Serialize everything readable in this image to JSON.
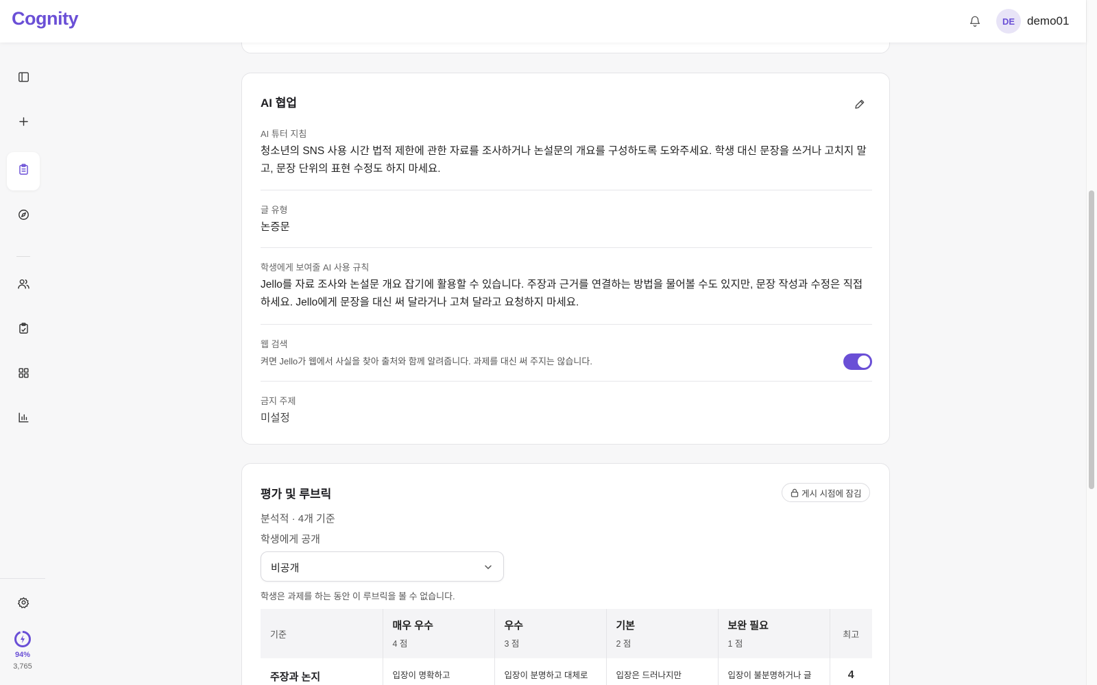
{
  "header": {
    "logo": "Cognity",
    "avatar_initials": "DE",
    "username": "demo01"
  },
  "sidebar": {
    "items": [
      {
        "icon": "sidebar-toggle-icon"
      },
      {
        "icon": "plus-icon"
      },
      {
        "icon": "clipboard-icon",
        "active": true
      },
      {
        "icon": "compass-icon"
      },
      {
        "icon": "users-icon"
      },
      {
        "icon": "clipboard-check-icon"
      },
      {
        "icon": "grid-icon"
      },
      {
        "icon": "bar-chart-icon"
      },
      {
        "icon": "gear-icon"
      }
    ],
    "usage_percent": "94%",
    "usage_count": "3,765"
  },
  "ai_section": {
    "title": "AI 협업",
    "tutor_label": "AI 튜터 지침",
    "tutor_text": "청소년의 SNS 사용 시간 법적 제한에 관한 자료를 조사하거나 논설문의 개요를 구성하도록 도와주세요. 학생 대신 문장을 쓰거나 고치지 말고, 문장 단위의 표현 수정도 하지 마세요.",
    "genre_label": "글 유형",
    "genre_value": "논증문",
    "rules_label": "학생에게 보여줄 AI 사용 규칙",
    "rules_text": "Jello를 자료 조사와 논설문 개요 잡기에 활용할 수 있습니다. 주장과 근거를 연결하는 방법을 물어볼 수도 있지만, 문장 작성과 수정은 직접 하세요. Jello에게 문장을 대신 써 달라거나 고쳐 달라고 요청하지 마세요.",
    "web_label": "웹 검색",
    "web_desc": "켜면 Jello가 웹에서 사실을 찾아 출처와 함께 알려줍니다. 과제를 대신 써 주지는 않습니다.",
    "web_enabled": true,
    "banned_label": "금지 주제",
    "banned_value": "미설정"
  },
  "rubric": {
    "title": "평가 및 루브릭",
    "lock_label": "게시 시점에 잠김",
    "summary": "분석적 · 4개 기준",
    "visibility_label": "학생에게 공개",
    "visibility_value": "비공개",
    "visibility_note": "학생은 과제를 하는 동안 이 루브릭을 볼 수 없습니다.",
    "table": {
      "criterion_header": "기준",
      "levels": [
        {
          "name": "매우 우수",
          "points": "4 점"
        },
        {
          "name": "우수",
          "points": "3 점"
        },
        {
          "name": "기본",
          "points": "2 점"
        },
        {
          "name": "보완 필요",
          "points": "1 점"
        }
      ],
      "max_header": "최고",
      "rows": [
        {
          "criterion": "주장과 논지",
          "cells": [
            "입장이 명확하고",
            "입장이 분명하고 대체로",
            "입장은 드러나지만",
            "입장이 불분명하거나 글"
          ],
          "max": "4"
        }
      ]
    }
  },
  "colors": {
    "accent": "#6a4fd6"
  }
}
